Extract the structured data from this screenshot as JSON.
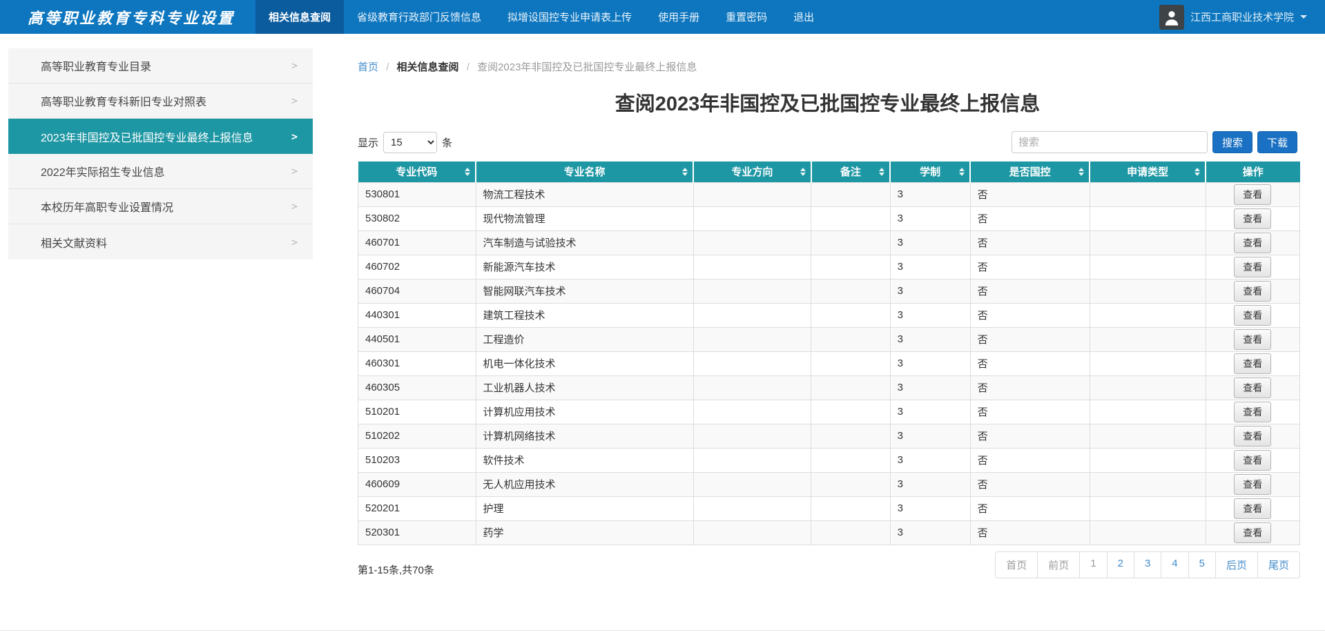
{
  "colors": {
    "navbar_bg": "#0d76bf",
    "navbar_active": "#0a5c9e",
    "teal": "#1e97a4",
    "link": "#428bca",
    "button_blue": "#1a70c2"
  },
  "navbar": {
    "brand": "高等职业教育专科专业设置",
    "items": [
      {
        "label": "相关信息查阅",
        "active": true
      },
      {
        "label": "省级教育行政部门反馈信息",
        "active": false
      },
      {
        "label": "拟增设国控专业申请表上传",
        "active": false
      },
      {
        "label": "使用手册",
        "active": false
      },
      {
        "label": "重置密码",
        "active": false
      },
      {
        "label": "退出",
        "active": false
      }
    ],
    "user_name": "江西工商职业技术学院"
  },
  "sidebar": {
    "chevron": ">",
    "items": [
      {
        "label": "高等职业教育专业目录",
        "active": false
      },
      {
        "label": "高等职业教育专科新旧专业对照表",
        "active": false
      },
      {
        "label": "2023年非国控及已批国控专业最终上报信息",
        "active": true
      },
      {
        "label": "2022年实际招生专业信息",
        "active": false
      },
      {
        "label": "本校历年高职专业设置情况",
        "active": false
      },
      {
        "label": "相关文献资料",
        "active": false
      }
    ]
  },
  "breadcrumb": {
    "home": "首页",
    "section": "相关信息查阅",
    "current": "查阅2023年非国控及已批国控专业最终上报信息"
  },
  "main": {
    "title": "查阅2023年非国控及已批国控专业最终上报信息",
    "length_control": {
      "prefix": "显示",
      "value": "15",
      "suffix": "条"
    },
    "search": {
      "placeholder": "搜索",
      "search_label": "搜索",
      "download_label": "下载"
    },
    "table": {
      "columns": [
        {
          "label": "专业代码",
          "key": "code",
          "sortable": true,
          "width": "12.5%"
        },
        {
          "label": "专业名称",
          "key": "name",
          "sortable": true,
          "width": "23.1%"
        },
        {
          "label": "专业方向",
          "key": "direction",
          "sortable": true,
          "width": "12.5%"
        },
        {
          "label": "备注",
          "key": "note",
          "sortable": true,
          "width": "8.4%"
        },
        {
          "label": "学制",
          "key": "duration",
          "sortable": true,
          "width": "8.5%"
        },
        {
          "label": "是否国控",
          "key": "national_control",
          "sortable": true,
          "width": "12.7%"
        },
        {
          "label": "申请类型",
          "key": "apply_type",
          "sortable": true,
          "width": "12.3%"
        },
        {
          "label": "操作",
          "key": "action",
          "sortable": false,
          "width": "10.0%"
        }
      ],
      "row_keys": [
        "code",
        "name",
        "direction",
        "note",
        "duration",
        "national_control",
        "apply_type"
      ],
      "action_label": "查看",
      "rows": [
        {
          "code": "530801",
          "name": "物流工程技术",
          "direction": "",
          "note": "",
          "duration": "3",
          "national_control": "否",
          "apply_type": ""
        },
        {
          "code": "530802",
          "name": "现代物流管理",
          "direction": "",
          "note": "",
          "duration": "3",
          "national_control": "否",
          "apply_type": ""
        },
        {
          "code": "460701",
          "name": "汽车制造与试验技术",
          "direction": "",
          "note": "",
          "duration": "3",
          "national_control": "否",
          "apply_type": ""
        },
        {
          "code": "460702",
          "name": "新能源汽车技术",
          "direction": "",
          "note": "",
          "duration": "3",
          "national_control": "否",
          "apply_type": ""
        },
        {
          "code": "460704",
          "name": "智能网联汽车技术",
          "direction": "",
          "note": "",
          "duration": "3",
          "national_control": "否",
          "apply_type": ""
        },
        {
          "code": "440301",
          "name": "建筑工程技术",
          "direction": "",
          "note": "",
          "duration": "3",
          "national_control": "否",
          "apply_type": ""
        },
        {
          "code": "440501",
          "name": "工程造价",
          "direction": "",
          "note": "",
          "duration": "3",
          "national_control": "否",
          "apply_type": ""
        },
        {
          "code": "460301",
          "name": "机电一体化技术",
          "direction": "",
          "note": "",
          "duration": "3",
          "national_control": "否",
          "apply_type": ""
        },
        {
          "code": "460305",
          "name": "工业机器人技术",
          "direction": "",
          "note": "",
          "duration": "3",
          "national_control": "否",
          "apply_type": ""
        },
        {
          "code": "510201",
          "name": "计算机应用技术",
          "direction": "",
          "note": "",
          "duration": "3",
          "national_control": "否",
          "apply_type": ""
        },
        {
          "code": "510202",
          "name": "计算机网络技术",
          "direction": "",
          "note": "",
          "duration": "3",
          "national_control": "否",
          "apply_type": ""
        },
        {
          "code": "510203",
          "name": "软件技术",
          "direction": "",
          "note": "",
          "duration": "3",
          "national_control": "否",
          "apply_type": ""
        },
        {
          "code": "460609",
          "name": "无人机应用技术",
          "direction": "",
          "note": "",
          "duration": "3",
          "national_control": "否",
          "apply_type": ""
        },
        {
          "code": "520201",
          "name": "护理",
          "direction": "",
          "note": "",
          "duration": "3",
          "national_control": "否",
          "apply_type": ""
        },
        {
          "code": "520301",
          "name": "药学",
          "direction": "",
          "note": "",
          "duration": "3",
          "national_control": "否",
          "apply_type": ""
        }
      ]
    },
    "footer": {
      "info": "第1-15条,共70条",
      "pagination": [
        {
          "label": "首页",
          "state": "disabled"
        },
        {
          "label": "前页",
          "state": "disabled"
        },
        {
          "label": "1",
          "state": "current"
        },
        {
          "label": "2",
          "state": "link"
        },
        {
          "label": "3",
          "state": "link"
        },
        {
          "label": "4",
          "state": "link"
        },
        {
          "label": "5",
          "state": "link"
        },
        {
          "label": "后页",
          "state": "link"
        },
        {
          "label": "尾页",
          "state": "link"
        }
      ]
    }
  }
}
